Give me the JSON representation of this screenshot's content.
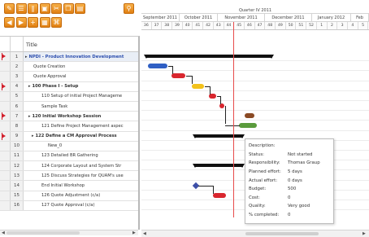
{
  "toolbar": {
    "row1": [
      {
        "icon": "edit-icon",
        "glyph": "✎"
      },
      {
        "icon": "tasks-icon",
        "glyph": "☰"
      },
      {
        "icon": "columns-icon",
        "glyph": "∥"
      },
      {
        "icon": "lock-icon",
        "glyph": "▣"
      },
      {
        "icon": "cut-icon",
        "glyph": "✂"
      },
      {
        "icon": "copy-icon",
        "glyph": "❐"
      },
      {
        "icon": "paste-icon",
        "glyph": "▤"
      }
    ],
    "row2": [
      {
        "icon": "arrow-left-icon",
        "glyph": "◀"
      },
      {
        "icon": "arrow-right-icon",
        "glyph": "▶"
      },
      {
        "icon": "add-task-icon",
        "glyph": "+"
      },
      {
        "icon": "document-icon",
        "glyph": "▦"
      },
      {
        "icon": "link-icon",
        "glyph": "⌘"
      }
    ],
    "search_icon": {
      "icon": "zoom-icon",
      "glyph": "⚲"
    }
  },
  "grid": {
    "title_header": "Title",
    "rows": [
      {
        "num": "1",
        "flag": true,
        "title": "NPDI - Product Innovation Development",
        "style": "link",
        "caret": "▸",
        "indent": 0
      },
      {
        "num": "2",
        "flag": false,
        "title": "Quote Creation",
        "style": "",
        "indent": 10
      },
      {
        "num": "3",
        "flag": false,
        "title": "Quote Approval",
        "style": "",
        "indent": 10
      },
      {
        "num": "4",
        "flag": true,
        "title": "100 Phase I - Setup",
        "style": "bold",
        "caret": "▸",
        "indent": 4
      },
      {
        "num": "5",
        "flag": false,
        "title": "110 Setup of initial Project Manageme",
        "style": "",
        "indent": 20
      },
      {
        "num": "6",
        "flag": false,
        "title": "Sample Task",
        "style": "",
        "indent": 20
      },
      {
        "num": "7",
        "flag": true,
        "title": "120 Initial Workshop Session",
        "style": "bold",
        "caret": "▸",
        "indent": 4
      },
      {
        "num": "8",
        "flag": false,
        "title": "121 Define Project Management aspec",
        "style": "",
        "indent": 20
      },
      {
        "num": "9",
        "flag": true,
        "title": "122 Define a CM Approval Process",
        "style": "bold",
        "caret": "▸",
        "indent": 8
      },
      {
        "num": "10",
        "flag": false,
        "title": "New_0",
        "style": "",
        "indent": 28
      },
      {
        "num": "11",
        "flag": false,
        "title": "123 Detailed BR Gathering",
        "style": "",
        "indent": 20
      },
      {
        "num": "12",
        "flag": false,
        "title": "124 Corporate Layout and System Str",
        "style": "",
        "indent": 20
      },
      {
        "num": "13",
        "flag": false,
        "title": "125 Discuss Strategies for QUAM's use",
        "style": "",
        "indent": 20
      },
      {
        "num": "14",
        "flag": false,
        "title": "End Initial Workshop",
        "style": "",
        "indent": 20
      },
      {
        "num": "15",
        "flag": false,
        "title": "126 Quote Adjustment (c/a)",
        "style": "",
        "indent": 20
      },
      {
        "num": "16",
        "flag": false,
        "title": "127 Quote Approval (c/a)",
        "style": "",
        "indent": 20
      }
    ]
  },
  "timeline": {
    "quarter": "Quarter IV 2011",
    "months": [
      "September 2011",
      "October 2011",
      "November 2011",
      "December 2011",
      "January 2012",
      "Feb"
    ],
    "weeks": [
      "36",
      "37",
      "38",
      "39",
      "40",
      "41",
      "42",
      "43",
      "44",
      "45",
      "46",
      "47",
      "48",
      "49",
      "50",
      "51",
      "52",
      "1",
      "2",
      "3",
      "4",
      "5"
    ]
  },
  "tooltip": {
    "rows": [
      {
        "k": "Description:",
        "v": ""
      },
      {
        "k": "Status:",
        "v": "Not started"
      },
      {
        "k": "Responsibility:",
        "v": "Thomas Graup"
      },
      {
        "k": "Planned effort:",
        "v": "5 days"
      },
      {
        "k": "Actual effort:",
        "v": "0 days"
      },
      {
        "k": "Budget:",
        "v": "500"
      },
      {
        "k": "Cost:",
        "v": "0"
      },
      {
        "k": "Quality:",
        "v": "Very good"
      },
      {
        "k": "% completed:",
        "v": "0"
      }
    ]
  },
  "colors": {
    "toolbar_orange": "#e8901f",
    "task_blue": "#2f5fc4",
    "task_red": "#d9262e",
    "task_yellow": "#f3c21b",
    "task_green": "#5a9b3c",
    "task_brown": "#8a4a24",
    "today_line": "#e84b4b",
    "flag_red": "#d21f2b"
  }
}
